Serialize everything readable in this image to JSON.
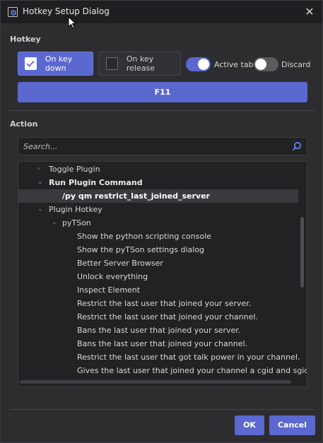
{
  "window": {
    "title": "Hotkey Setup Dialog",
    "close_glyph": "✕"
  },
  "hotkey": {
    "section_label": "Hotkey",
    "on_key_down_label": "On key down",
    "on_key_down_checked": true,
    "on_key_release_label": "On key release",
    "on_key_release_checked": false,
    "active_tab_label": "Active tab",
    "active_tab_on": true,
    "discard_label": "Discard",
    "discard_on": false,
    "key_label": "F11"
  },
  "action": {
    "section_label": "Action",
    "search_placeholder": "Search...",
    "tree": [
      {
        "label": "Toggle Plugin",
        "level": 0,
        "arrow": "›",
        "style": "normal"
      },
      {
        "label": "Run Plugin Command",
        "level": 0,
        "arrow": "⌄",
        "style": "bold"
      },
      {
        "label": "/py qm restrict_last_joined_server",
        "level": 1,
        "arrow": "",
        "style": "selected"
      },
      {
        "label": "Plugin Hotkey",
        "level": 0,
        "arrow": "⌄",
        "style": "normal"
      },
      {
        "label": "pyTSon",
        "level": 1,
        "arrow": "⌄",
        "style": "normal"
      },
      {
        "label": "Show the python scripting console",
        "level": 2,
        "arrow": "",
        "style": "normal"
      },
      {
        "label": "Show the pyTSon settings dialog",
        "level": 2,
        "arrow": "",
        "style": "normal"
      },
      {
        "label": "Better Server Browser",
        "level": 2,
        "arrow": "",
        "style": "normal"
      },
      {
        "label": "Unlock everything",
        "level": 2,
        "arrow": "",
        "style": "normal"
      },
      {
        "label": "Inspect Element",
        "level": 2,
        "arrow": "",
        "style": "normal"
      },
      {
        "label": "Restrict the last user that joined your server.",
        "level": 2,
        "arrow": "",
        "style": "normal"
      },
      {
        "label": "Restrict the last user that joined your channel.",
        "level": 2,
        "arrow": "",
        "style": "normal"
      },
      {
        "label": "Bans the last user that joined your server.",
        "level": 2,
        "arrow": "",
        "style": "normal"
      },
      {
        "label": "Bans the last user that joined your channel.",
        "level": 2,
        "arrow": "",
        "style": "normal"
      },
      {
        "label": "Restrict the last user that got talk power in your channel.",
        "level": 2,
        "arrow": "",
        "style": "normal"
      },
      {
        "label": "Gives the last user that joined your channel a cgid and sgid",
        "level": 2,
        "arrow": "",
        "style": "normal"
      }
    ]
  },
  "buttons": {
    "ok_label": "OK",
    "cancel_label": "Cancel"
  },
  "icons": {
    "app": "gear-window-icon",
    "close": "close-icon",
    "search": "search-icon",
    "check": "checkmark-icon",
    "cursor": "mouse-cursor-icon"
  },
  "colors": {
    "accent": "#5b68cf",
    "background": "#2d2d30",
    "titlebar": "#1f1f21",
    "field": "#222224"
  }
}
